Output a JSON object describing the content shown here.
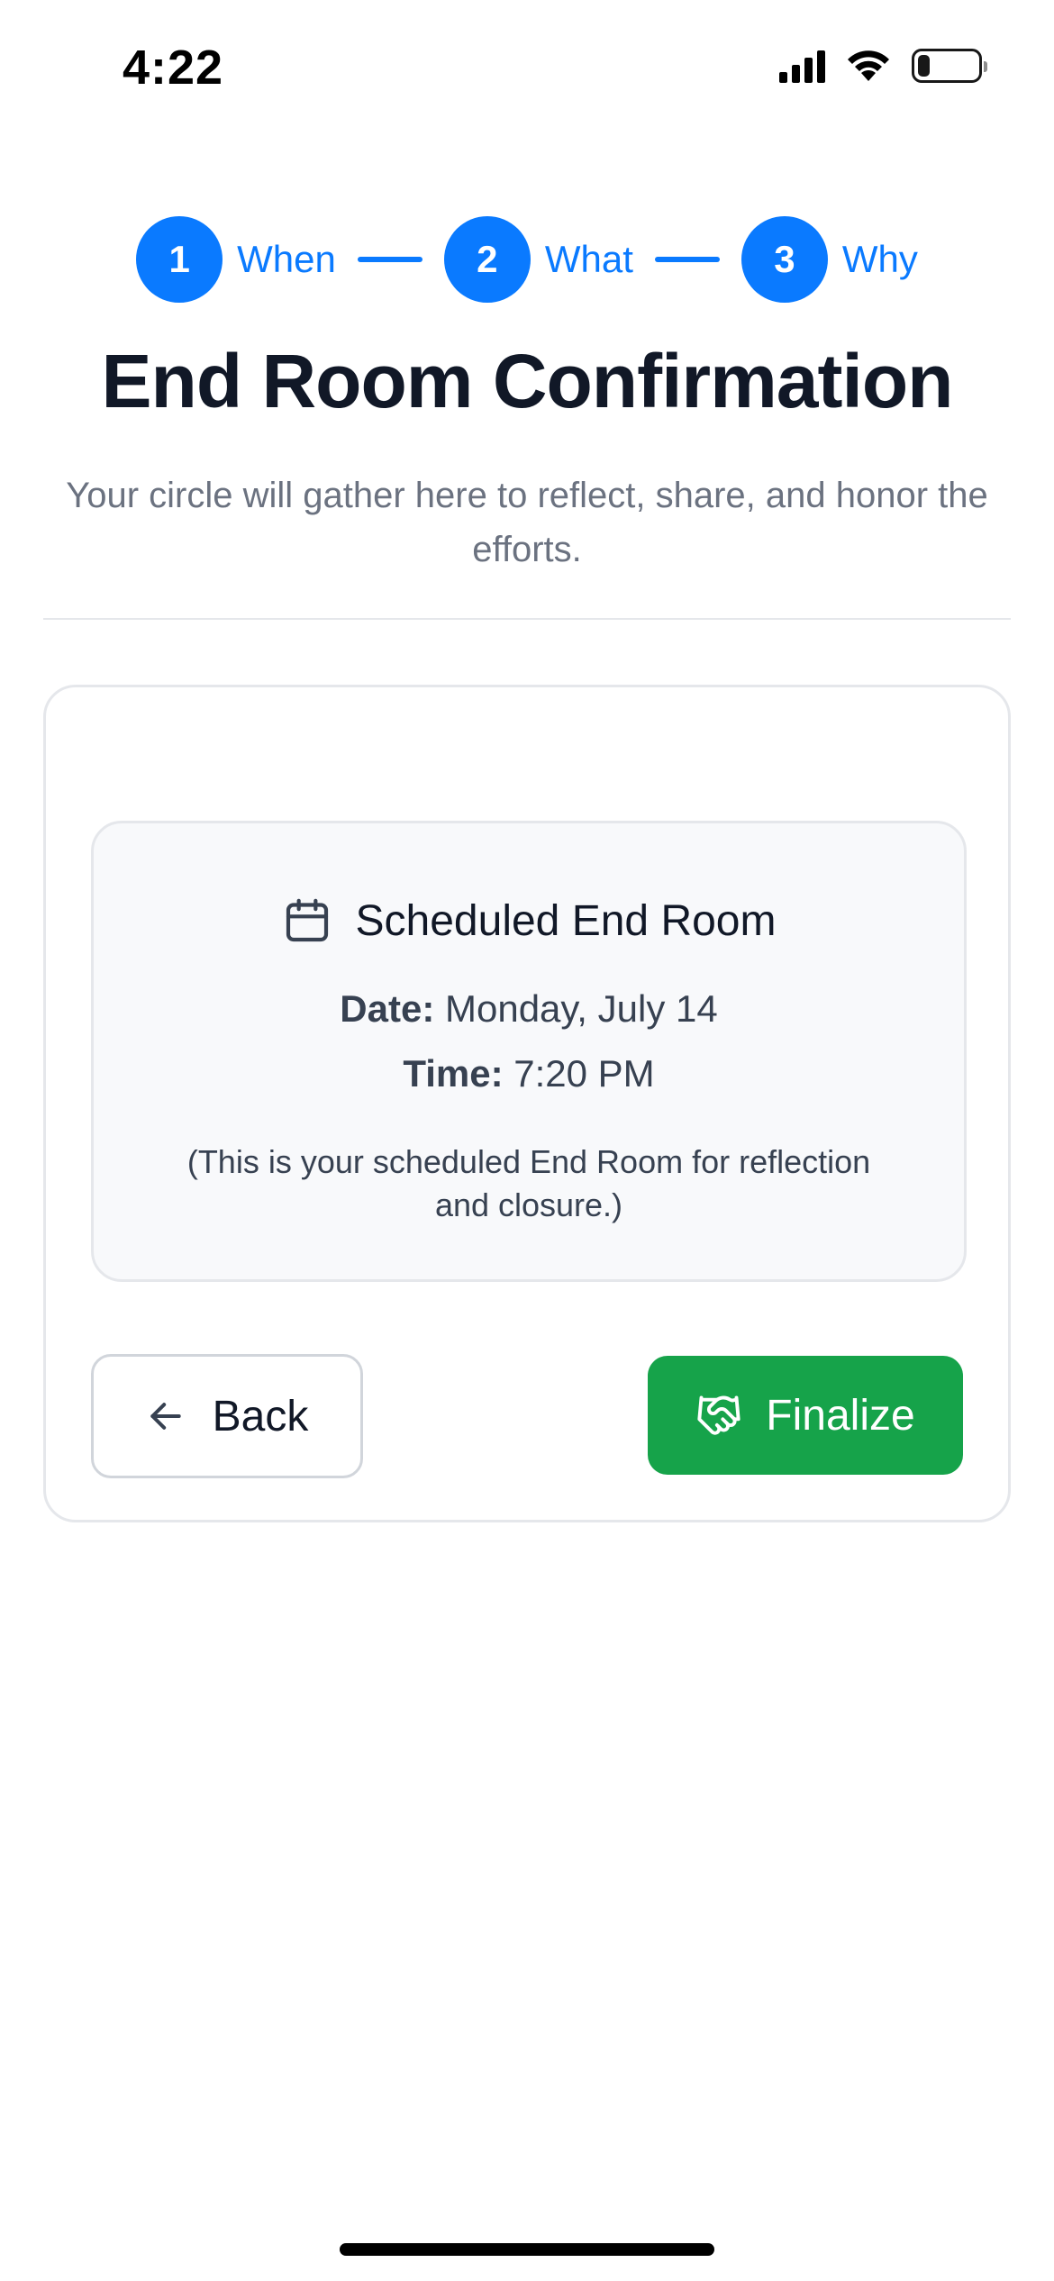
{
  "status_bar": {
    "time": "4:22",
    "battery_level": 0.2
  },
  "stepper": {
    "steps": [
      {
        "number": "1",
        "label": "When"
      },
      {
        "number": "2",
        "label": "What"
      },
      {
        "number": "3",
        "label": "Why"
      }
    ],
    "color": "#0a7aff"
  },
  "header": {
    "title": "End Room Confirmation",
    "subtitle": "Your circle will gather here to reflect, share, and honor the efforts."
  },
  "schedule": {
    "heading": "Scheduled End Room",
    "date_label": "Date:",
    "date_value": "Monday, July 14",
    "time_label": "Time:",
    "time_value": "7:20 PM",
    "note": "(This is your scheduled End Room for reflection and closure.)",
    "icon": "calendar-icon"
  },
  "actions": {
    "back_label": "Back",
    "finalize_label": "Finalize",
    "finalize_color": "#16a34a",
    "back_icon": "arrow-left-icon",
    "finalize_icon": "handshake-icon"
  }
}
